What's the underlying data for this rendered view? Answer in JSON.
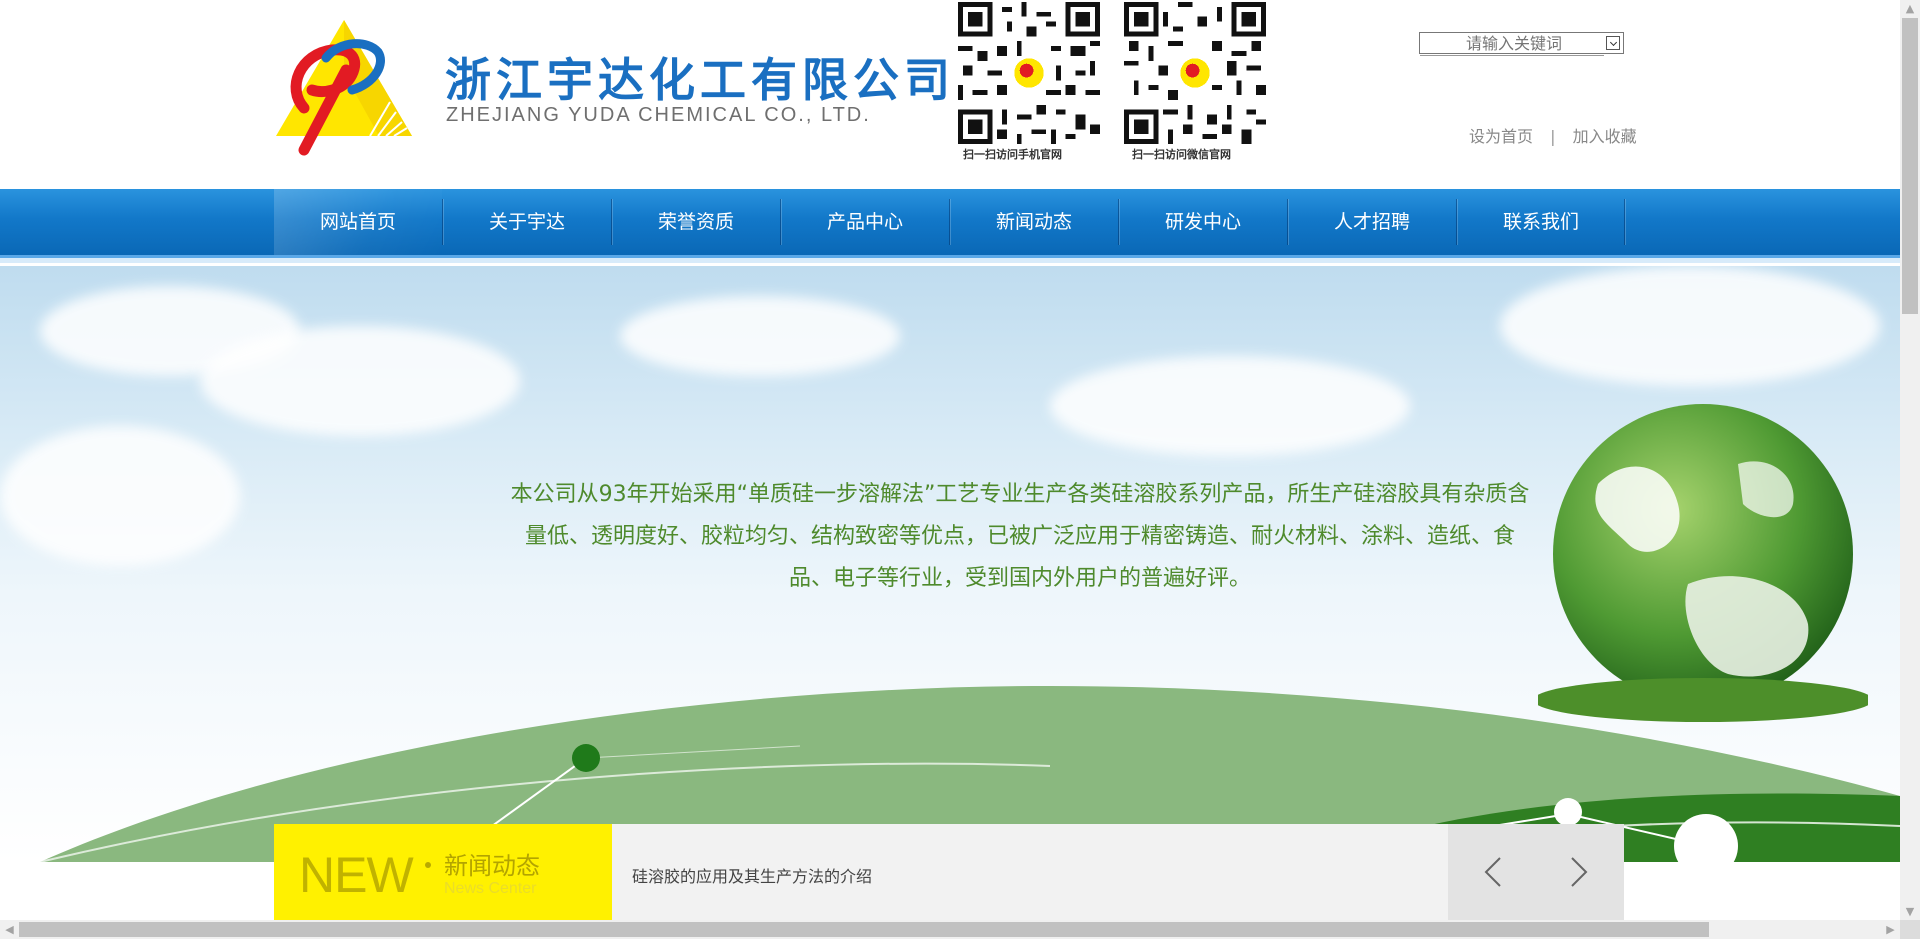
{
  "header": {
    "company_name_cn": "浙江宇达化工有限公司",
    "company_name_en": "ZHEJIANG YUDA CHEMICAL CO., LTD.",
    "qr_mobile_caption": "扫一扫访问手机官网",
    "qr_wechat_caption": "扫一扫访问微信官网",
    "search": {
      "placeholder": "请输入关键词"
    },
    "links": {
      "set_home": "设为首页",
      "separator": "|",
      "add_favorite": "加入收藏"
    },
    "colors": {
      "brand_blue": "#1a6fc1",
      "logo_yellow": "#ffe600",
      "logo_red": "#e21b23"
    }
  },
  "nav": {
    "items": [
      {
        "label": "网站首页",
        "active": true
      },
      {
        "label": "关于宇达"
      },
      {
        "label": "荣誉资质"
      },
      {
        "label": "产品中心"
      },
      {
        "label": "新闻动态"
      },
      {
        "label": "研发中心"
      },
      {
        "label": "人才招聘"
      },
      {
        "label": "联系我们"
      }
    ],
    "colors": {
      "bar": "#1278c9"
    }
  },
  "banner": {
    "text": "本公司从93年开始采用“单质硅一步溶解法”工艺专业生产各类硅溶胶系列产品，所生产硅溶胶具有杂质含量低、透明度好、胶粒均匀、结构致密等优点，已被广泛应用于精密铸造、耐火材料、涂料、造纸、食品、电子等行业，受到国内外用户的普遍好评。",
    "colors": {
      "text": "#4e8a2c",
      "hill": "#8ab87f"
    }
  },
  "news": {
    "label_new": "NEW",
    "label_cn": "新闻动态",
    "label_en": "News Center",
    "headline": "硅溶胶的应用及其生产方法的介绍",
    "colors": {
      "label_bg": "#fff100"
    }
  },
  "icons": {
    "prev": "chevron-left-icon",
    "next": "chevron-right-icon",
    "search": "search-submit-icon",
    "scroll_up": "triangle-up-icon",
    "scroll_down": "triangle-down-icon",
    "scroll_left": "triangle-left-icon",
    "scroll_right": "triangle-right-icon"
  }
}
